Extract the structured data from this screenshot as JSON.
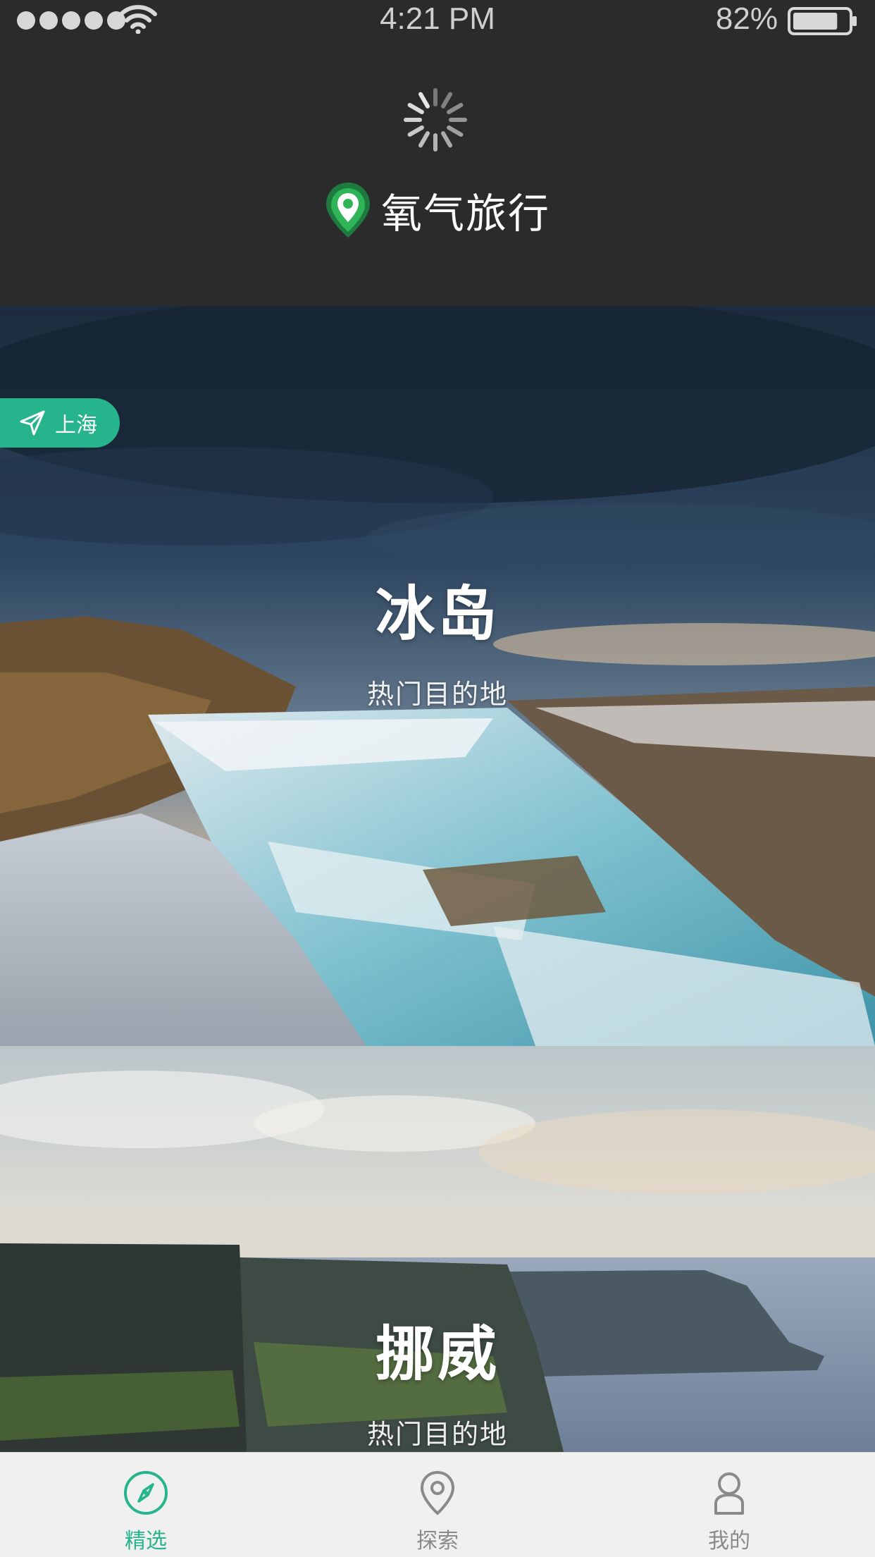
{
  "status_bar": {
    "time": "4:21 PM",
    "battery_percent": "82%",
    "battery_level": 0.82,
    "signal_dots": 5,
    "icons": [
      "signal-dots-icon",
      "wifi-icon",
      "battery-icon"
    ]
  },
  "header": {
    "loading": true,
    "brand_name": "氧气旅行",
    "logo_icon": "map-pin-logo-icon"
  },
  "location_badge": {
    "label": "上海",
    "icon": "paper-plane-icon"
  },
  "destinations": [
    {
      "title": "冰岛",
      "subtitle": "热门目的地"
    },
    {
      "title": "挪威",
      "subtitle": "热门目的地"
    }
  ],
  "tabbar": {
    "tabs": [
      {
        "label": "精选",
        "icon": "compass-icon",
        "active": true
      },
      {
        "label": "探索",
        "icon": "map-pin-icon",
        "active": false
      },
      {
        "label": "我的",
        "icon": "user-icon",
        "active": false
      }
    ]
  },
  "colors": {
    "accent": "#26b48c",
    "header_bg": "#2b2b2b",
    "tabbar_bg": "#f0f0f0",
    "tab_inactive": "#8a8a8a"
  }
}
